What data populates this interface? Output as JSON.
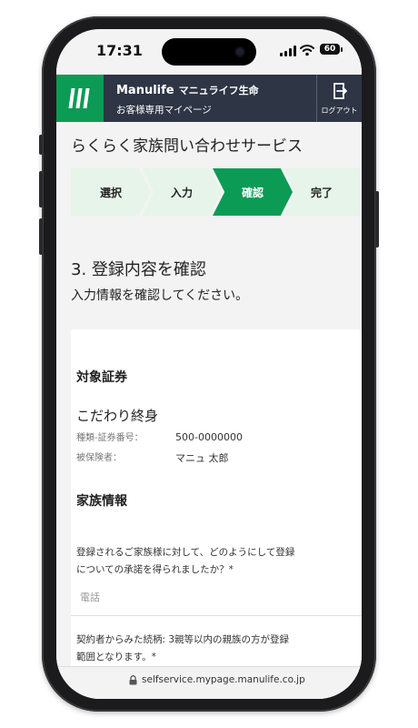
{
  "status_bar": {
    "time": "17:31",
    "battery": "60"
  },
  "header": {
    "brand": "Manulife",
    "brand_jp": "マニュライフ生命",
    "subtitle": "お客様専用マイページ",
    "logout_label": "ログアウト",
    "accent_color": "#0b9b55",
    "bg_color": "#2e3545"
  },
  "page_title": "らくらく家族問い合わせサービス",
  "steps": [
    {
      "label": "選択",
      "active": false
    },
    {
      "label": "入力",
      "active": false
    },
    {
      "label": "確認",
      "active": true
    },
    {
      "label": "完了",
      "active": false
    }
  ],
  "section": {
    "heading": "3. 登録内容を確認",
    "description": "入力情報を確認してください。"
  },
  "policy": {
    "heading": "対象証券",
    "product_name": "こだわり終身",
    "fields": [
      {
        "label": "種類-証券番号：",
        "value": "500-0000000"
      },
      {
        "label": "被保険者：",
        "value": "マニュ 太郎"
      }
    ]
  },
  "family": {
    "heading": "家族情報",
    "question1": "登録されるご家族様に対して、どのようにして登録についての承諾を得られましたか？*",
    "answer1": "電話",
    "question2": "契約者からみた続柄: 3親等以内の親族の方が登録範囲となります。*"
  },
  "browser": {
    "url": "selfservice.mypage.manulife.co.jp"
  },
  "icons": {
    "logo": "manulife-logo-icon",
    "logout": "logout-icon",
    "lock": "lock-icon"
  }
}
